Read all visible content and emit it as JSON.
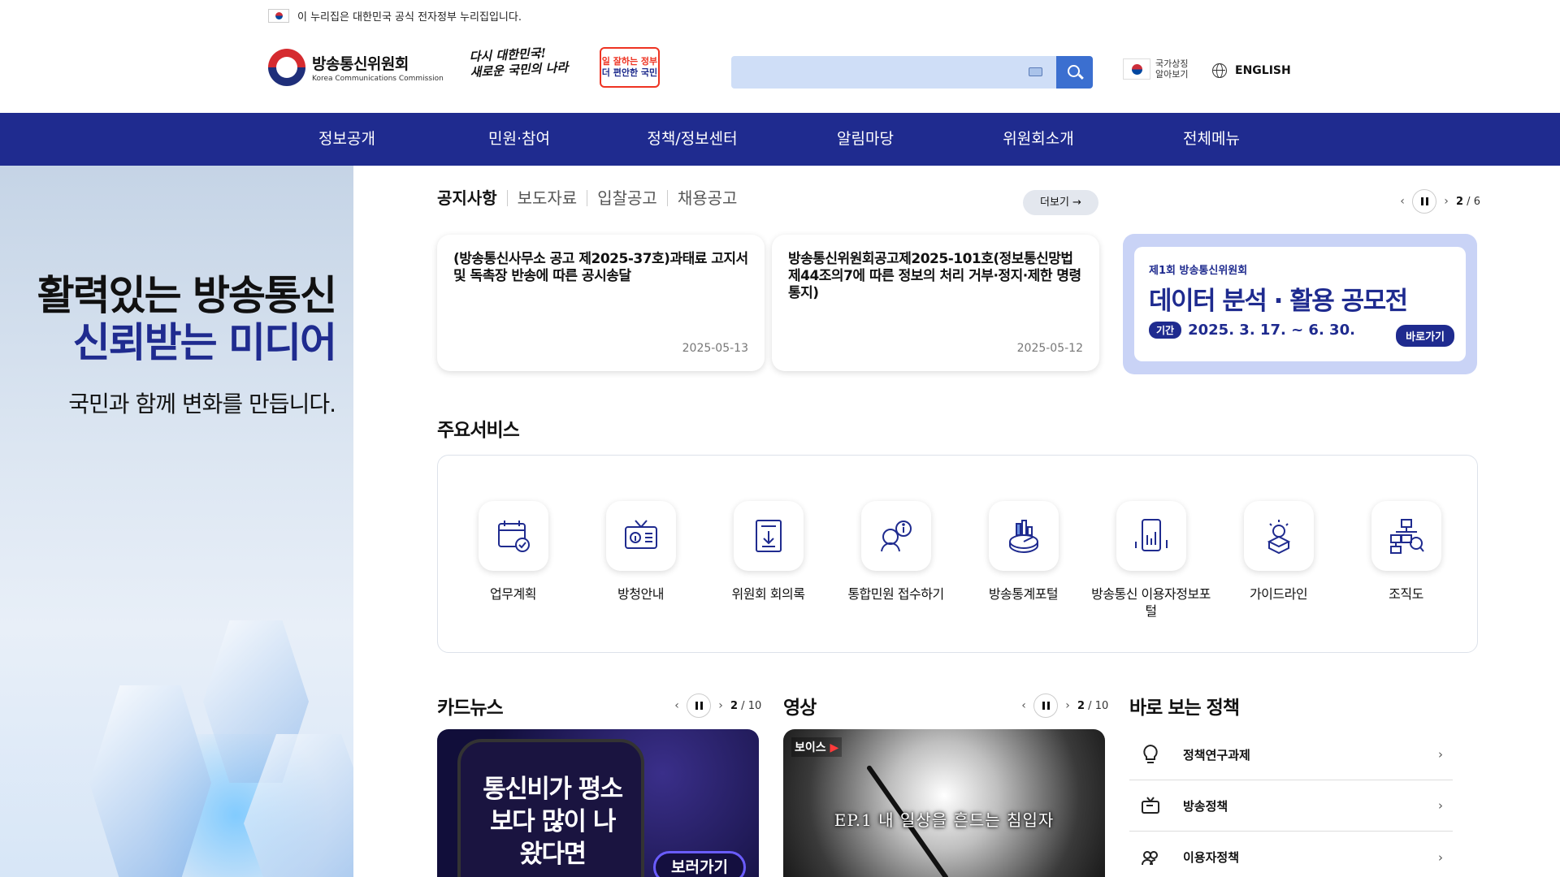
{
  "gov_banner": {
    "text": "이 누리집은 대한민국 공식 전자정부 누리집입니다."
  },
  "header": {
    "logo_ko": "방송통신위원회",
    "logo_en": "Korea Communications Commission",
    "slogan_line1": "다시 대한민국!",
    "slogan_line2": "새로운 국민의 나라",
    "badge_line1": "일 잘하는 정부",
    "badge_line2": "더 편안한 국민",
    "search_placeholder": "",
    "national_symbol": "국가상징 알아보기",
    "language": "ENGLISH"
  },
  "nav": {
    "items": [
      "정보공개",
      "민원·참여",
      "정책/정보센터",
      "알림마당",
      "위원회소개",
      "전체메뉴"
    ]
  },
  "hero": {
    "line1": "활력있는 방송통신",
    "line2": "신뢰받는 미디어",
    "sub": "국민과 함께 변화를 만듭니다."
  },
  "notices": {
    "tabs": [
      "공지사항",
      "보도자료",
      "입찰공고",
      "채용공고"
    ],
    "more_label": "더보기",
    "pager_current": "2",
    "pager_total": "6",
    "items": [
      {
        "title": "(방송통신사무소 공고 제2025-37호)과태료 고지서 및 독촉장 반송에 따른 공시송달",
        "date": "2025-05-13"
      },
      {
        "title": "방송통신위원회공고제2025-101호(정보통신망법 제44조의7에 따른 정보의 처리 거부·정지·제한 명령 통지)",
        "date": "2025-05-12"
      }
    ]
  },
  "promo": {
    "eyebrow": "제1회 방송통신위원회",
    "title": "데이터 분석 · 활용 공모전",
    "period_label": "기간",
    "period": "2025. 3. 17. ~ 6. 30.",
    "go_label": "바로가기"
  },
  "services": {
    "title": "주요서비스",
    "items": [
      {
        "label": "업무계획",
        "icon": "calendar-check-icon"
      },
      {
        "label": "방청안내",
        "icon": "tv-info-icon"
      },
      {
        "label": "위원회 회의록",
        "icon": "document-download-icon"
      },
      {
        "label": "통합민원 접수하기",
        "icon": "person-info-icon"
      },
      {
        "label": "방송통계포털",
        "icon": "chart-pie-icon"
      },
      {
        "label": "방송통신 이용자정보포털",
        "icon": "phone-chart-icon"
      },
      {
        "label": "가이드라인",
        "icon": "lightbulb-box-icon"
      },
      {
        "label": "조직도",
        "icon": "org-chart-icon"
      }
    ]
  },
  "cardnews": {
    "title": "카드뉴스",
    "pager_current": "2",
    "pager_total": "10",
    "text": "통신비가 평소보다 많이 나왔다면",
    "button": "보러가기"
  },
  "video": {
    "title": "영상",
    "pager_current": "2",
    "pager_total": "10",
    "badge": "보이스",
    "caption": "EP.1 내 일상을 흔드는 침입자"
  },
  "policy": {
    "title": "바로 보는 정책",
    "items": [
      {
        "label": "정책연구과제",
        "icon": "lightbulb-icon"
      },
      {
        "label": "방송정책",
        "icon": "tv-icon"
      },
      {
        "label": "이용자정책",
        "icon": "users-icon"
      }
    ]
  }
}
